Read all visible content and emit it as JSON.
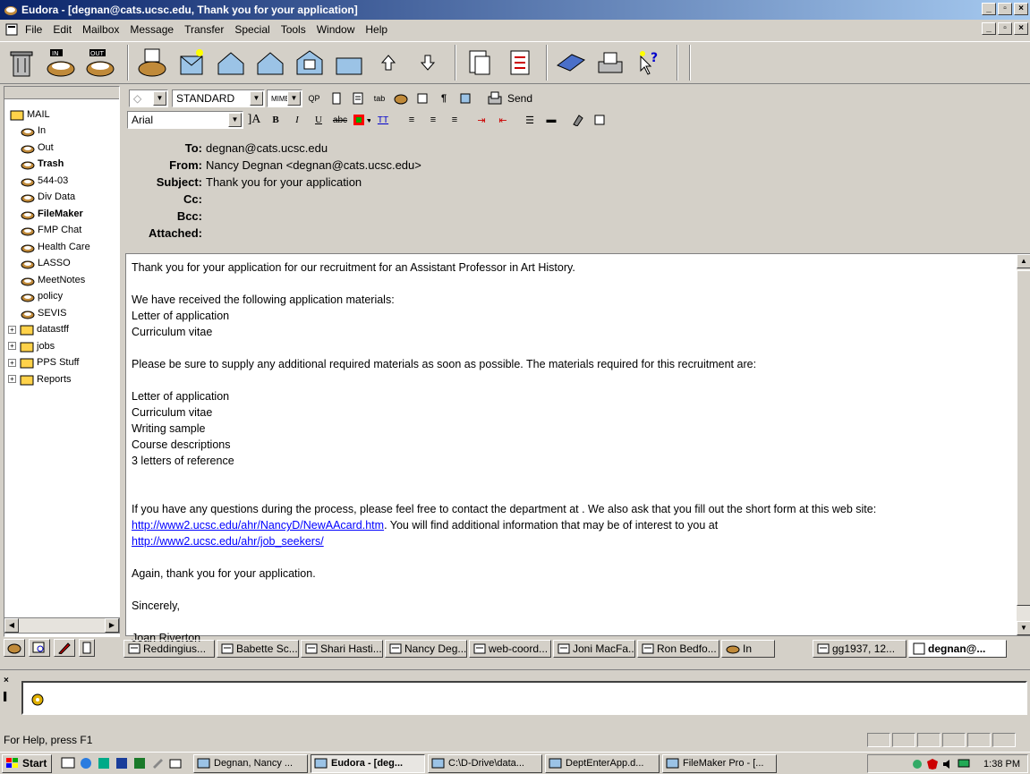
{
  "window": {
    "title": "Eudora - [degnan@cats.ucsc.edu, Thank you for your application]"
  },
  "menu": [
    "File",
    "Edit",
    "Mailbox",
    "Message",
    "Transfer",
    "Special",
    "Tools",
    "Window",
    "Help"
  ],
  "toolbar_labels": {
    "in": "IN",
    "out": "OUT"
  },
  "mailboxes": {
    "root": "MAIL",
    "items": [
      {
        "label": "In",
        "bold": false
      },
      {
        "label": "Out",
        "bold": false
      },
      {
        "label": "Trash",
        "bold": true
      },
      {
        "label": "544-03",
        "bold": false
      },
      {
        "label": "Div Data",
        "bold": false
      },
      {
        "label": "FileMaker",
        "bold": true
      },
      {
        "label": "FMP Chat",
        "bold": false
      },
      {
        "label": "Health Care",
        "bold": false
      },
      {
        "label": "LASSO",
        "bold": false
      },
      {
        "label": "MeetNotes",
        "bold": false
      },
      {
        "label": "policy",
        "bold": false
      },
      {
        "label": "SEVIS",
        "bold": false
      },
      {
        "label": "datastff",
        "bold": false
      },
      {
        "label": "jobs",
        "bold": false
      },
      {
        "label": "PPS Stuff",
        "bold": false
      },
      {
        "label": "Reports",
        "bold": false
      }
    ]
  },
  "compose": {
    "style": "STANDARD",
    "mime": "MIME",
    "qp": "QP",
    "send": "Send",
    "font": "Arial"
  },
  "headers": {
    "to_label": "To:",
    "to": "degnan@cats.ucsc.edu",
    "from_label": "From:",
    "from": "Nancy Degnan <degnan@cats.ucsc.edu>",
    "subject_label": "Subject:",
    "subject": "Thank you for your application",
    "cc_label": "Cc:",
    "bcc_label": "Bcc:",
    "attached_label": "Attached:"
  },
  "body": {
    "p1": "Thank you for your application for our recruitment for an Assistant Professor in Art History.",
    "p2a": "We have received the following application materials:",
    "p2b": "Letter of application",
    "p2c": "Curriculum vitae",
    "p3": "Please be sure to supply any additional required materials as soon as possible.  The materials required for this recruitment are:",
    "req": [
      "Letter of application",
      "Curriculum vitae",
      "Writing sample",
      "Course descriptions",
      "3 letters of reference"
    ],
    "p4a": "If you have any questions during the process, please feel free to contact the department at .  We  also ask that you fill out the short form at this web site:  ",
    "link1": "http://www2.ucsc.edu/ahr/NancyD/NewAAcard.htm",
    "p4b": ".  You will find additional information that may be of interest to you at",
    "link2": "http://www2.ucsc.edu/ahr/job_seekers/",
    "p5": "Again, thank you for your application.",
    "p6": "Sincerely,",
    "p7": "Joan Riverton"
  },
  "tabs": [
    "Reddingius...",
    "Babette Sc...",
    "Shari Hasti...",
    "Nancy Deg...",
    "web-coord...",
    "Joni MacFa...",
    "Ron Bedfo...",
    "In",
    "gg1937, 12...",
    "degnan@..."
  ],
  "status": "For Help, press F1",
  "taskbar": {
    "start": "Start",
    "tasks": [
      "Degnan, Nancy ...",
      "Eudora - [deg...",
      "C:\\D-Drive\\data...",
      "DeptEnterApp.d...",
      "FileMaker Pro - [..."
    ],
    "time": "1:38 PM"
  },
  "colors": {
    "titlebar": "#0a246a",
    "link": "#0000ff",
    "face": "#d4d0c8"
  }
}
